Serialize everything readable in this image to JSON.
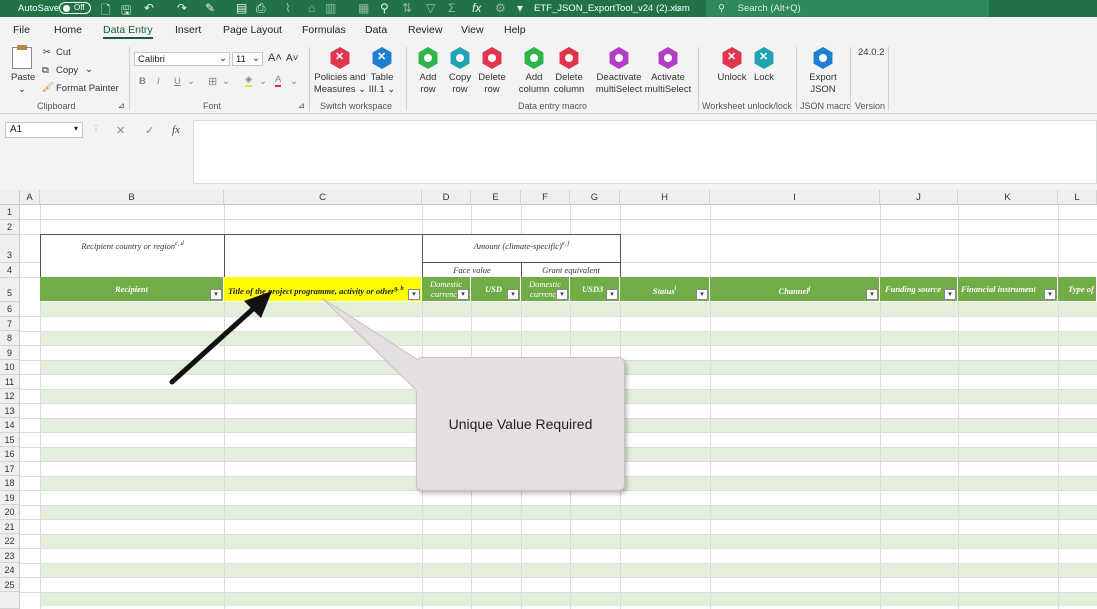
{
  "titlebar": {
    "autosave_label": "AutoSave",
    "autosave_state": "Off",
    "filename": "ETF_JSON_ExportTool_v24 (2).xlsm",
    "search_placeholder": "Search (Alt+Q)"
  },
  "menu": {
    "items": [
      "File",
      "Home",
      "Data Entry",
      "Insert",
      "Page Layout",
      "Formulas",
      "Data",
      "Review",
      "View",
      "Help"
    ],
    "active": "Data Entry"
  },
  "ribbon": {
    "clipboard": {
      "paste": "Paste",
      "cut": "Cut",
      "copy": "Copy",
      "format_painter": "Format Painter",
      "group": "Clipboard"
    },
    "font": {
      "family": "Calibri",
      "size": "11",
      "group": "Font"
    },
    "switch_workspace": {
      "policies_line1": "Policies and",
      "policies_line2": "Measures",
      "table_line1": "Table",
      "table_line2": "III.1",
      "group": "Switch workspace"
    },
    "data_entry_macro": {
      "add_row_1": "Add",
      "add_row_2": "row",
      "copy_row_1": "Copy",
      "copy_row_2": "row",
      "delete_row_1": "Delete",
      "delete_row_2": "row",
      "add_col_1": "Add",
      "add_col_2": "column",
      "delete_col_1": "Delete",
      "delete_col_2": "column",
      "deactivate_1": "Deactivate",
      "deactivate_2": "multiSelect",
      "activate_1": "Activate",
      "activate_2": "multiSelect",
      "group": "Data entry macro"
    },
    "worksheet": {
      "unlock": "Unlock",
      "lock": "Lock",
      "group": "Worksheet unlock/lock"
    },
    "json_macro": {
      "export_1": "Export",
      "export_2": "JSON",
      "group": "JSON macro"
    },
    "version": {
      "value": "24.0.2",
      "group": "Version"
    },
    "colors": {
      "green_icon": "#2fb44a",
      "teal_icon": "#1fa3b5",
      "red_icon": "#e0344d",
      "purple_icon": "#b33dc6",
      "blue_icon": "#1e7fd1"
    }
  },
  "formula_bar": {
    "name_box": "A1",
    "fx": "fx",
    "content": ""
  },
  "sheet": {
    "columns": [
      "A",
      "B",
      "C",
      "D",
      "E",
      "F",
      "G",
      "H",
      "I",
      "J",
      "K",
      "L"
    ],
    "rows": [
      "1",
      "2",
      "3",
      "4",
      "5",
      "6",
      "7",
      "8",
      "9",
      "10",
      "11",
      "12",
      "13",
      "14",
      "15",
      "16",
      "17",
      "18",
      "19",
      "20",
      "21",
      "22",
      "23",
      "24",
      "25"
    ],
    "row3": {
      "recipient_region": "Recipient country or region",
      "recipient_region_sup": "c, d",
      "amount": "Amount (climate-specific)",
      "amount_sup": "e, f"
    },
    "row4": {
      "face_value": "Face value",
      "grant_equivalent": "Grant equivalent"
    },
    "header_row": {
      "recipient": "Recipient",
      "title": "Title of the project programme, activity or other",
      "title_sup": "g, h",
      "dom_curr_1": "Domestic",
      "dom_curr_2": "currency",
      "usd": "USD",
      "dom_curr2_1": "Domestic",
      "dom_curr2_2": "currency",
      "usd3": "USD3",
      "status": "Status",
      "status_sup": "i",
      "channel": "Channel",
      "channel_sup": "j",
      "funding": "Funding source",
      "instrument": "Financial instrument",
      "type_of": "Type of"
    },
    "colors": {
      "header_green": "#70ad47",
      "band_green": "#e2efda",
      "highlight_yellow": "#ffff00"
    }
  },
  "callout": {
    "text": "Unique Value Required"
  }
}
